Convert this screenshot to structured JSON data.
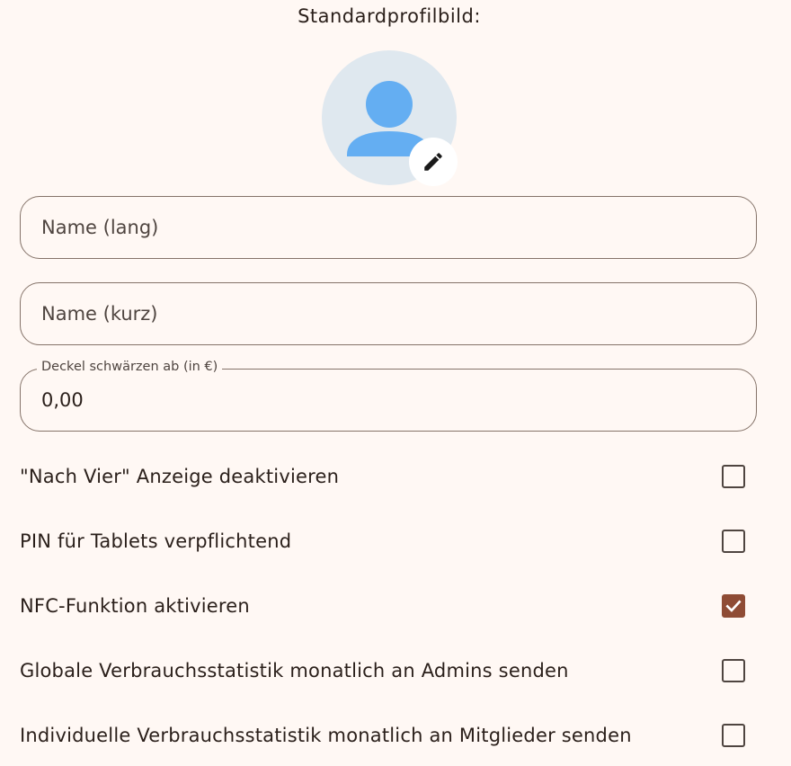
{
  "profile": {
    "title": "Standardprofilbild:",
    "avatar_icon": "person-icon",
    "edit_icon": "pencil-icon"
  },
  "fields": {
    "name_long": {
      "placeholder": "Name (lang)",
      "value": ""
    },
    "name_short": {
      "placeholder": "Name (kurz)",
      "value": ""
    },
    "blacken_threshold": {
      "label": "Deckel schwärzen ab (in €)",
      "value": "0,00"
    }
  },
  "options": [
    {
      "label": "\"Nach Vier\" Anzeige deaktivieren",
      "checked": false
    },
    {
      "label": "PIN für Tablets verpflichtend",
      "checked": false
    },
    {
      "label": "NFC-Funktion aktivieren",
      "checked": true
    },
    {
      "label": "Globale Verbrauchsstatistik monatlich an Admins senden",
      "checked": false
    },
    {
      "label": "Individuelle Verbrauchsstatistik monatlich an Mitglieder senden",
      "checked": false
    }
  ],
  "colors": {
    "background": "#fff8f4",
    "accent": "#8f4c35",
    "avatar_bg": "#dfe8ef",
    "avatar_figure": "#64aef2",
    "outline": "#857369"
  }
}
